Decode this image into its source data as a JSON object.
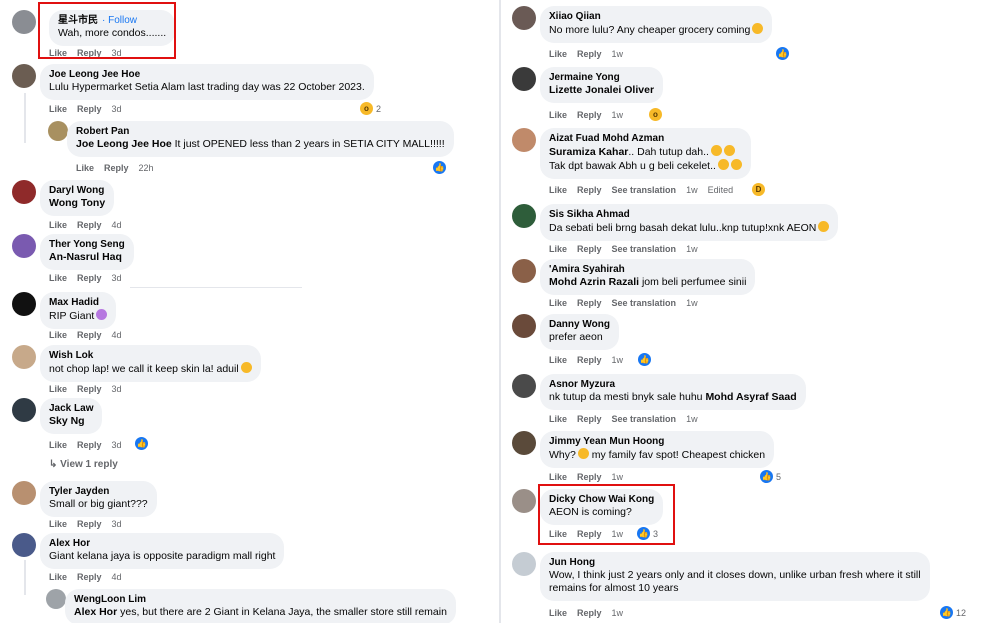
{
  "left": {
    "c1": {
      "name": "星斗市民",
      "follow": "· Follow",
      "text": "Wah, more condos.......",
      "like": "Like",
      "reply": "Reply",
      "time": "3d"
    },
    "c2": {
      "name": "Joe Leong Jee Hoe",
      "text": "Lulu Hypermarket Setia Alam last trading day was 22 October 2023.",
      "like": "Like",
      "reply": "Reply",
      "time": "3d",
      "react_count": "2"
    },
    "c3": {
      "name": "Robert Pan",
      "mention": "Joe Leong Jee Hoe",
      "text": " It just OPENED less than 2 years in SETIA CITY MALL!!!!!",
      "like": "Like",
      "reply": "Reply",
      "time": "22h"
    },
    "c4": {
      "name": "Daryl Wong",
      "mention": "Wong Tony",
      "like": "Like",
      "reply": "Reply",
      "time": "4d"
    },
    "c5": {
      "name": "Ther Yong Seng",
      "mention": "An-Nasrul Haq",
      "like": "Like",
      "reply": "Reply",
      "time": "3d"
    },
    "c6": {
      "name": "Max Hadid",
      "text": "RIP Giant",
      "like": "Like",
      "reply": "Reply",
      "time": "4d"
    },
    "c7": {
      "name": "Wish Lok",
      "text": "not chop lap! we call it keep skin la! aduil",
      "like": "Like",
      "reply": "Reply",
      "time": "3d"
    },
    "c8": {
      "name": "Jack Law",
      "mention": "Sky Ng",
      "like": "Like",
      "reply": "Reply",
      "time": "3d",
      "view_reply": "View 1 reply"
    },
    "c9": {
      "name": "Tyler Jayden",
      "text": "Small or big giant???",
      "like": "Like",
      "reply": "Reply",
      "time": "3d"
    },
    "c10": {
      "name": "Alex Hor",
      "text": "Giant kelana jaya is opposite paradigm mall right",
      "like": "Like",
      "reply": "Reply",
      "time": "4d"
    },
    "c11": {
      "name": "WengLoon Lim",
      "mention": "Alex Hor",
      "text": " yes, but there are 2 Giant in Kelana Jaya, the smaller store still remain"
    }
  },
  "right": {
    "r1": {
      "name": "Xiiao Qiian",
      "text": "No more lulu? Any cheaper grocery coming",
      "like": "Like",
      "reply": "Reply",
      "time": "1w"
    },
    "r2": {
      "name": "Jermaine Yong",
      "mention": "Lizette Jonalei Oliver",
      "like": "Like",
      "reply": "Reply",
      "time": "1w"
    },
    "r3": {
      "name": "Aizat Fuad Mohd Azman",
      "mention": "Suramiza Kahar",
      "text1": ".. Dah tutup dah..",
      "text2": "Tak dpt bawak Abh u g beli cekelet..",
      "like": "Like",
      "reply": "Reply",
      "translate": "See translation",
      "time": "1w",
      "edited": "Edited"
    },
    "r4": {
      "name": "Sis Sikha Ahmad",
      "text": "Da sebati beli brng basah dekat lulu..knp tutup!xnk AEON",
      "like": "Like",
      "reply": "Reply",
      "translate": "See translation",
      "time": "1w"
    },
    "r5": {
      "name": "'Amira Syahirah",
      "mention": "Mohd Azrin Razali",
      "text": " jom beli perfumee sinii",
      "like": "Like",
      "reply": "Reply",
      "translate": "See translation",
      "time": "1w"
    },
    "r6": {
      "name": "Danny Wong",
      "text": "prefer aeon",
      "like": "Like",
      "reply": "Reply",
      "time": "1w"
    },
    "r7": {
      "name": "Asnor Myzura",
      "text": "nk tutup da mesti bnyk sale huhu ",
      "mention": "Mohd Asyraf Saad",
      "like": "Like",
      "reply": "Reply",
      "translate": "See translation",
      "time": "1w"
    },
    "r8": {
      "name": "Jimmy Yean Mun Hoong",
      "text1": "Why?",
      "text2": " my family fav spot! Cheapest chicken",
      "like": "Like",
      "reply": "Reply",
      "time": "1w",
      "react_count": "5"
    },
    "r9": {
      "name": "Dicky Chow Wai Kong",
      "text": "AEON is coming?",
      "like": "Like",
      "reply": "Reply",
      "time": "1w",
      "react_count": "3"
    },
    "r10": {
      "name": "Jun Hong",
      "text1": "Wow, I think just 2 years only and it closes down, unlike urban fresh where it still",
      "text2": "remains for almost 10 years",
      "like": "Like",
      "reply": "Reply",
      "time": "1w",
      "react_count": "12"
    }
  },
  "colors": {
    "highlight": "#e01010",
    "link": "#1877f2",
    "bubble": "#f0f2f5",
    "meta": "#65676b"
  }
}
